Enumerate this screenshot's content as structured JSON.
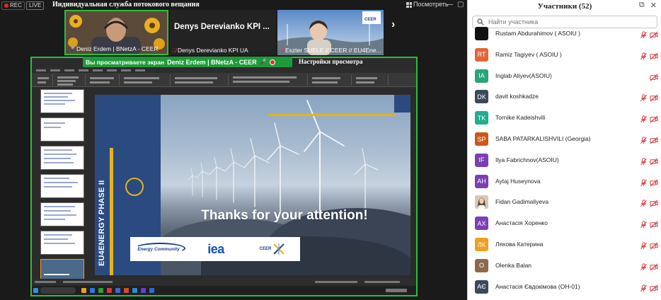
{
  "topbar": {
    "rec_label": "REC",
    "live_label": "LIVE",
    "stream_title": "Индивидуальная служба потокового вещания",
    "view_label": "Посмотреть"
  },
  "tiles": [
    {
      "name": "Deniz Erdem | BNetzA - CEER",
      "mic": "on"
    },
    {
      "name": "Denys Derevianko KPI UA",
      "big_name": "Denys Derevianko KPI ...",
      "mic": "off"
    },
    {
      "name": "Eszter SUELE // CEER // EU4Ene...",
      "mic": "off"
    }
  ],
  "share_banner": {
    "text": "Вы просматриваете экран",
    "presenter": "Deniz Erdem | BNetzA - CEER",
    "view_options": "Настройки просмотра"
  },
  "slide": {
    "vertical_text": "EU4ENERGY PHASE II",
    "headline": "Thanks for your attention!",
    "logos": {
      "energy_community": "Energy Community",
      "iea": "iea",
      "ceer": "CEER"
    }
  },
  "participants_panel": {
    "title": "Участники (52)",
    "search_placeholder": "Найти участника",
    "participants": [
      {
        "name": "Rustam Abdurahimov ( ASOIU )",
        "initials": "",
        "color": "#111111",
        "mic_muted": true,
        "cam_off": true
      },
      {
        "name": "Ramiz Tagiyev ( ASOIU )",
        "initials": "RT",
        "color": "#e0663a",
        "mic_muted": true,
        "cam_off": true
      },
      {
        "name": "Inglab Aliyev(ASOIU)",
        "initials": "IA",
        "color": "#2aa37a",
        "mic_muted": false,
        "cam_off": true
      },
      {
        "name": "davit koshkadze",
        "initials": "DK",
        "color": "#3a4a5c",
        "mic_muted": true,
        "cam_off": true
      },
      {
        "name": "Tornike Kadeishvili",
        "initials": "TK",
        "color": "#1fae8e",
        "mic_muted": true,
        "cam_off": true
      },
      {
        "name": "SABA PATARKALISHVILI (Georgia)",
        "initials": "SP",
        "color": "#c85a1e",
        "mic_muted": true,
        "cam_off": true
      },
      {
        "name": "Ilya Fabrichnov(ASOIU)",
        "initials": "IF",
        "color": "#7b3fb5",
        "mic_muted": true,
        "cam_off": true
      },
      {
        "name": "Aytaj Huseynova",
        "initials": "AH",
        "color": "#7b3fb5",
        "mic_muted": true,
        "cam_off": true
      },
      {
        "name": "Fidan Gadimaliyeva",
        "initials": "",
        "color": "#b07a5a",
        "mic_muted": true,
        "cam_off": true
      },
      {
        "name": "Анастасія Хоренко",
        "initials": "АХ",
        "color": "#7b3fb5",
        "mic_muted": true,
        "cam_off": true
      },
      {
        "name": "Ляхова Катерина",
        "initials": "ЛК",
        "color": "#f0a020",
        "mic_muted": true,
        "cam_off": true
      },
      {
        "name": "Olenka Balan",
        "initials": "O",
        "color": "#8a6a50",
        "mic_muted": true,
        "cam_off": true
      },
      {
        "name": "Анастасія Євдокімова (ОН-01)",
        "initials": "АЄ",
        "color": "#3a4a5c",
        "mic_muted": true,
        "cam_off": true
      }
    ]
  },
  "colors": {
    "share_green": "#2bbf3b",
    "banner_green": "#1f9a3a",
    "slide_blue": "#2a4a80",
    "slide_gold": "#e6b21e",
    "muted_red": "#e03a3a"
  }
}
